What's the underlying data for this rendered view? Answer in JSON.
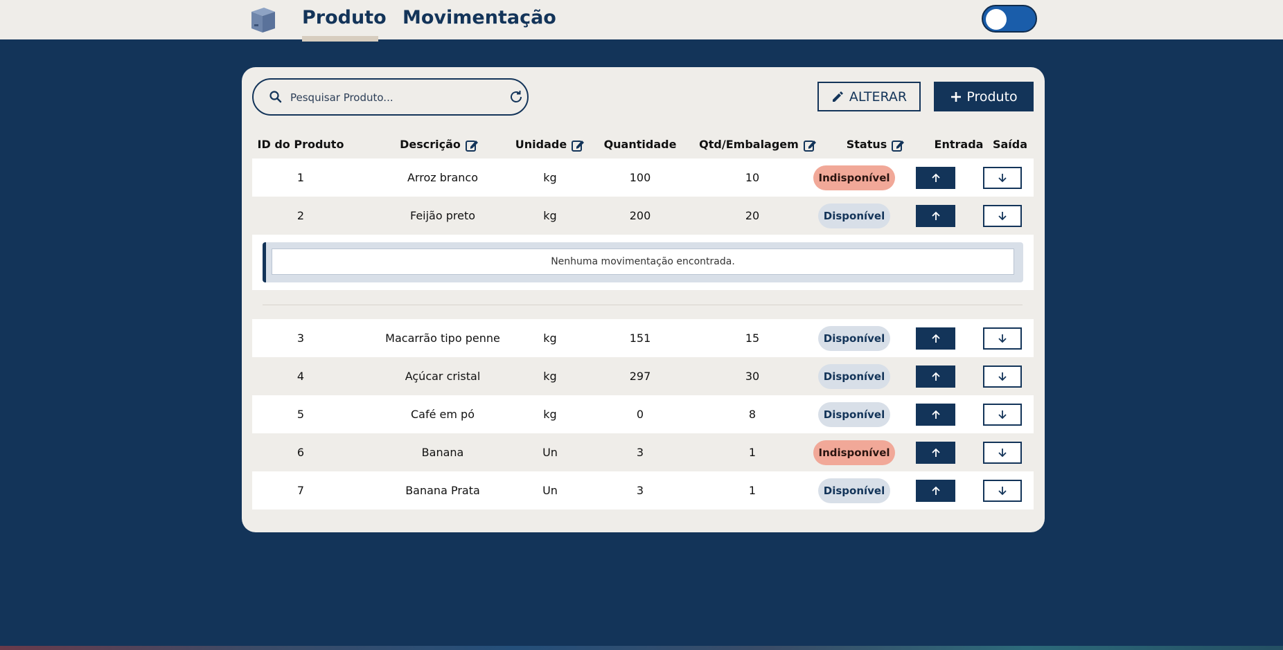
{
  "nav": {
    "tabs": [
      {
        "label": "Produto",
        "active": true
      },
      {
        "label": "Movimentação",
        "active": false
      }
    ],
    "logo_icon": "box-icon",
    "theme_toggle_on": true
  },
  "toolbar": {
    "search_placeholder": "Pesquisar Produto...",
    "search_value": "",
    "alterar_label": "ALTERAR",
    "add_label": "Produto"
  },
  "table": {
    "headers": {
      "id": "ID do Produto",
      "descricao": "Descrição",
      "unidade": "Unidade",
      "quantidade": "Quantidade",
      "qtd_emb": "Qtd/Embalagem",
      "status": "Status",
      "entrada": "Entrada",
      "saida": "Saída"
    },
    "rows": [
      {
        "id": "1",
        "descricao": "Arroz branco",
        "unidade": "kg",
        "quantidade": "100",
        "qtd_emb": "10",
        "status": "Indisponível"
      },
      {
        "id": "2",
        "descricao": "Feijão preto",
        "unidade": "kg",
        "quantidade": "200",
        "qtd_emb": "20",
        "status": "Disponível"
      },
      {
        "id": "3",
        "descricao": "Macarrão tipo penne",
        "unidade": "kg",
        "quantidade": "151",
        "qtd_emb": "15",
        "status": "Disponível"
      },
      {
        "id": "4",
        "descricao": "Açúcar cristal",
        "unidade": "kg",
        "quantidade": "297",
        "qtd_emb": "30",
        "status": "Disponível"
      },
      {
        "id": "5",
        "descricao": "Café em pó",
        "unidade": "kg",
        "quantidade": "0",
        "qtd_emb": "8",
        "status": "Disponível"
      },
      {
        "id": "6",
        "descricao": "Banana",
        "unidade": "Un",
        "quantidade": "3",
        "qtd_emb": "1",
        "status": "Indisponível"
      },
      {
        "id": "7",
        "descricao": "Banana Prata",
        "unidade": "Un",
        "quantidade": "3",
        "qtd_emb": "1",
        "status": "Disponível"
      }
    ],
    "expanded_message": "Nenhuma movimentação encontrada."
  },
  "colors": {
    "primary": "#133459",
    "surface": "#efede9",
    "badge_unavailable": "#f1a898",
    "badge_available": "#d8dfe8"
  }
}
